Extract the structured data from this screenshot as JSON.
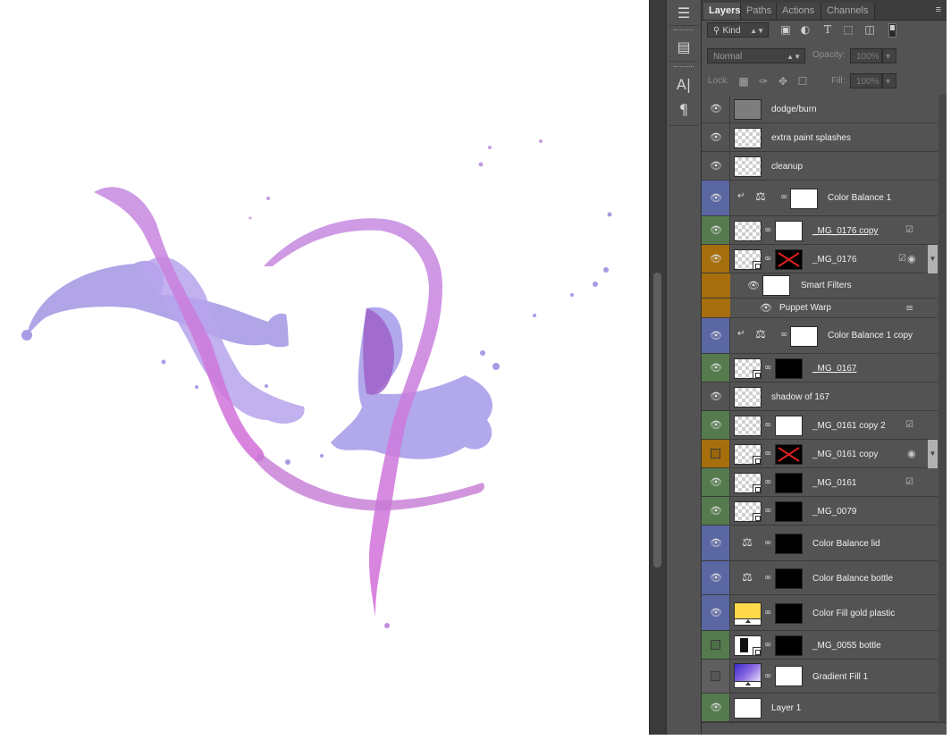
{
  "tabs": [
    {
      "label": "Layers",
      "active": true
    },
    {
      "label": "Paths",
      "active": false
    },
    {
      "label": "Actions",
      "active": false
    },
    {
      "label": "Channels",
      "active": false
    }
  ],
  "panel_menu_icon": "panel-menu-icon",
  "filter": {
    "kind_label": "Kind",
    "icons": [
      "pixel-filter-icon",
      "adjustment-filter-icon",
      "type-filter-icon",
      "shape-filter-icon",
      "smart-object-filter-icon"
    ]
  },
  "blend": {
    "mode": "Normal",
    "opacity_label": "Opacity:",
    "opacity_value": "100%"
  },
  "lock": {
    "label": "Lock:",
    "icons": [
      "lock-transparent-icon",
      "lock-paint-icon",
      "lock-move-icon",
      "lock-all-icon"
    ],
    "fill_label": "Fill:",
    "fill_value": "100%"
  },
  "tool_strip_icons": [
    "brush-presets-icon",
    "clone-source-icon",
    "character-panel-icon",
    "paragraph-panel-icon"
  ],
  "colors": {
    "purple_label": "#5b67a3",
    "green_label": "#557a4e",
    "orange_label": "#a66e0d",
    "gray_label": "#5f5f5f",
    "splash_violet": "#a99be6",
    "splash_magenta": "#c15bd2"
  },
  "layers": [
    {
      "name": "dodge/burn"
    },
    {
      "name": "extra paint splashes"
    },
    {
      "name": "cleanup"
    },
    {
      "name": "Color Balance 1"
    },
    {
      "name": "_MG_0176 copy"
    },
    {
      "name": "_MG_0176"
    },
    {
      "name": "Smart Filters"
    },
    {
      "name": "Puppet Warp"
    },
    {
      "name": "Color Balance 1 copy"
    },
    {
      "name": "_MG_0167"
    },
    {
      "name": "shadow of 167"
    },
    {
      "name": "_MG_0161 copy 2"
    },
    {
      "name": "_MG_0161 copy"
    },
    {
      "name": "_MG_0161"
    },
    {
      "name": "_MG_0079"
    },
    {
      "name": "Color Balance lid"
    },
    {
      "name": "Color Balance bottle"
    },
    {
      "name": "Color Fill gold plastic"
    },
    {
      "name": "_MG_0055 bottle"
    },
    {
      "name": "Gradient Fill 1"
    },
    {
      "name": "Layer 1"
    }
  ]
}
